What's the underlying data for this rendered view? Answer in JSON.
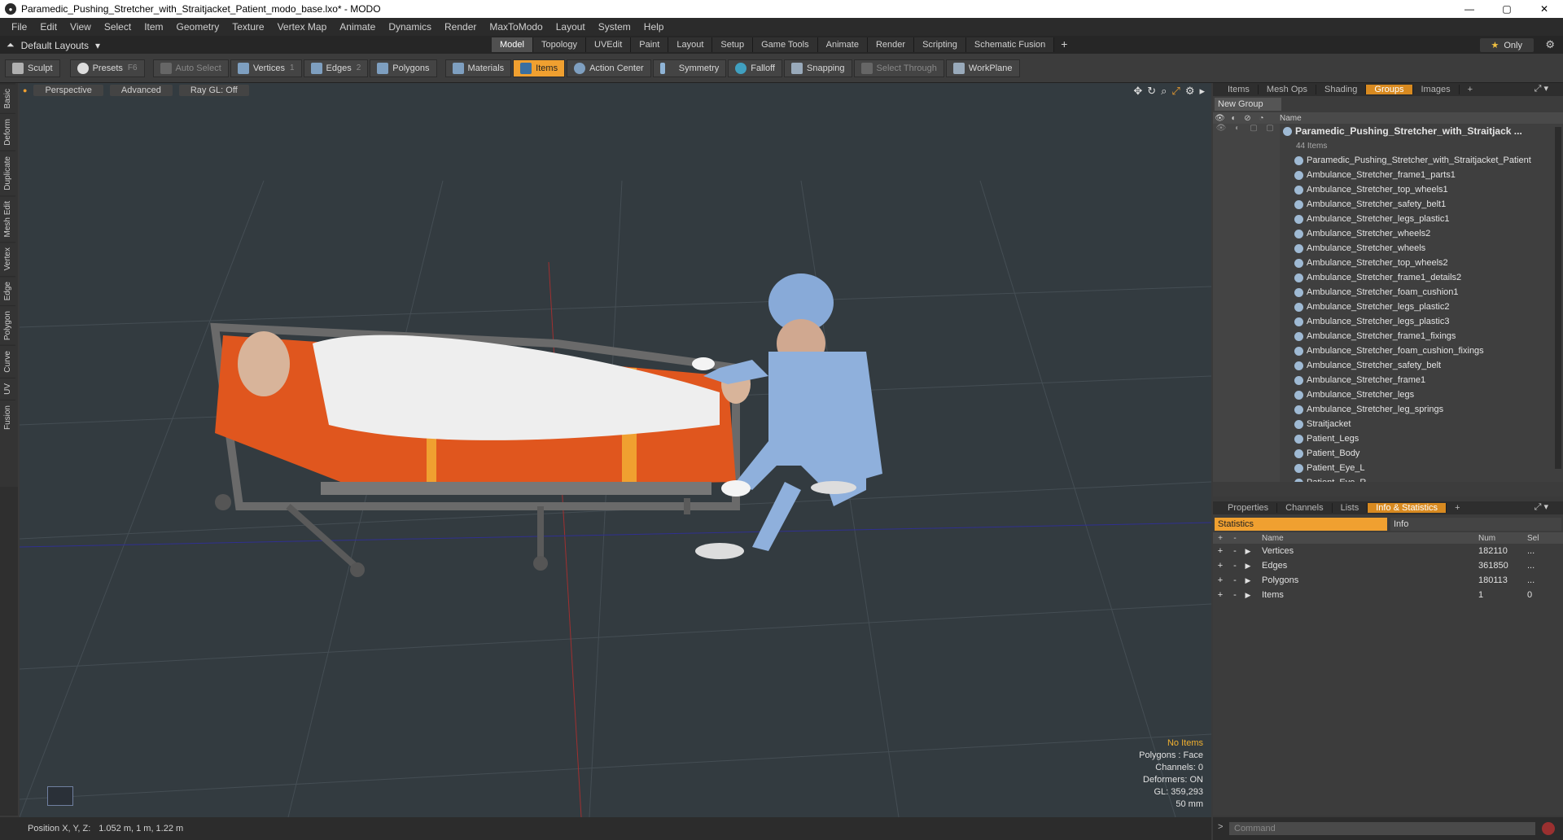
{
  "window": {
    "title": "Paramedic_Pushing_Stretcher_with_Straitjacket_Patient_modo_base.lxo* - MODO",
    "controls": [
      "—",
      "▢",
      "✕"
    ]
  },
  "menu": [
    "File",
    "Edit",
    "View",
    "Select",
    "Item",
    "Geometry",
    "Texture",
    "Vertex Map",
    "Animate",
    "Dynamics",
    "Render",
    "MaxToModo",
    "Layout",
    "System",
    "Help"
  ],
  "layout_bar": {
    "layouts_label": "Default Layouts",
    "tabs": [
      "Model",
      "Topology",
      "UVEdit",
      "Paint",
      "Layout",
      "Setup",
      "Game Tools",
      "Animate",
      "Render",
      "Scripting",
      "Schematic Fusion"
    ],
    "active_tab": "Model",
    "only_label": "Only"
  },
  "toolbar": {
    "sculpt": "Sculpt",
    "presets": "Presets",
    "presets_key": "F6",
    "auto_select": "Auto Select",
    "vertices": "Vertices",
    "vertices_key": "1",
    "edges": "Edges",
    "edges_key": "2",
    "polygons": "Polygons",
    "materials": "Materials",
    "items": "Items",
    "action_center": "Action Center",
    "symmetry": "Symmetry",
    "falloff": "Falloff",
    "snapping": "Snapping",
    "select_through": "Select Through",
    "workplane": "WorkPlane"
  },
  "left_tabs": [
    "Basic",
    "Deform",
    "Duplicate",
    "Mesh Edit",
    "Vertex",
    "Edge",
    "Polygon",
    "Curve",
    "UV",
    "Fusion"
  ],
  "viewport": {
    "view_mode": "Perspective",
    "shading": "Advanced",
    "raygl": "Ray GL: Off",
    "info": {
      "selection": "No Items",
      "polygons": "Polygons : Face",
      "channels": "Channels: 0",
      "deformers": "Deformers: ON",
      "gl": "GL: 359,293",
      "focal": "50 mm"
    }
  },
  "status": {
    "label": "Position X, Y, Z:",
    "value": "1.052 m, 1 m, 1.22 m"
  },
  "groups_panel": {
    "tabs": [
      "Items",
      "Mesh Ops",
      "Shading",
      "Groups",
      "Images"
    ],
    "active_tab": "Groups",
    "new_group": "New Group",
    "name_header": "Name",
    "root": "Paramedic_Pushing_Stretcher_with_Straitjack ...",
    "root_count": "44 Items",
    "items": [
      "Paramedic_Pushing_Stretcher_with_Straitjacket_Patient",
      "Ambulance_Stretcher_frame1_parts1",
      "Ambulance_Stretcher_top_wheels1",
      "Ambulance_Stretcher_safety_belt1",
      "Ambulance_Stretcher_legs_plastic1",
      "Ambulance_Stretcher_wheels2",
      "Ambulance_Stretcher_wheels",
      "Ambulance_Stretcher_top_wheels2",
      "Ambulance_Stretcher_frame1_details2",
      "Ambulance_Stretcher_foam_cushion1",
      "Ambulance_Stretcher_legs_plastic2",
      "Ambulance_Stretcher_legs_plastic3",
      "Ambulance_Stretcher_frame1_fixings",
      "Ambulance_Stretcher_foam_cushion_fixings",
      "Ambulance_Stretcher_safety_belt",
      "Ambulance_Stretcher_frame1",
      "Ambulance_Stretcher_legs",
      "Ambulance_Stretcher_leg_springs",
      "Straitjacket",
      "Patient_Legs",
      "Patient_Body",
      "Patient_Eye_L",
      "Patient_Eye_R"
    ]
  },
  "stats_panel": {
    "tabs": [
      "Properties",
      "Channels",
      "Lists",
      "Info & Statistics"
    ],
    "active_tab": "Info & Statistics",
    "sub_tabs": [
      "Statistics",
      "Info"
    ],
    "headers": {
      "name": "Name",
      "num": "Num",
      "sel": "Sel"
    },
    "rows": [
      {
        "name": "Vertices",
        "num": "182110",
        "sel": "..."
      },
      {
        "name": "Edges",
        "num": "361850",
        "sel": "..."
      },
      {
        "name": "Polygons",
        "num": "180113",
        "sel": "..."
      },
      {
        "name": "Items",
        "num": "1",
        "sel": "0"
      }
    ]
  },
  "command": {
    "placeholder": "Command"
  }
}
